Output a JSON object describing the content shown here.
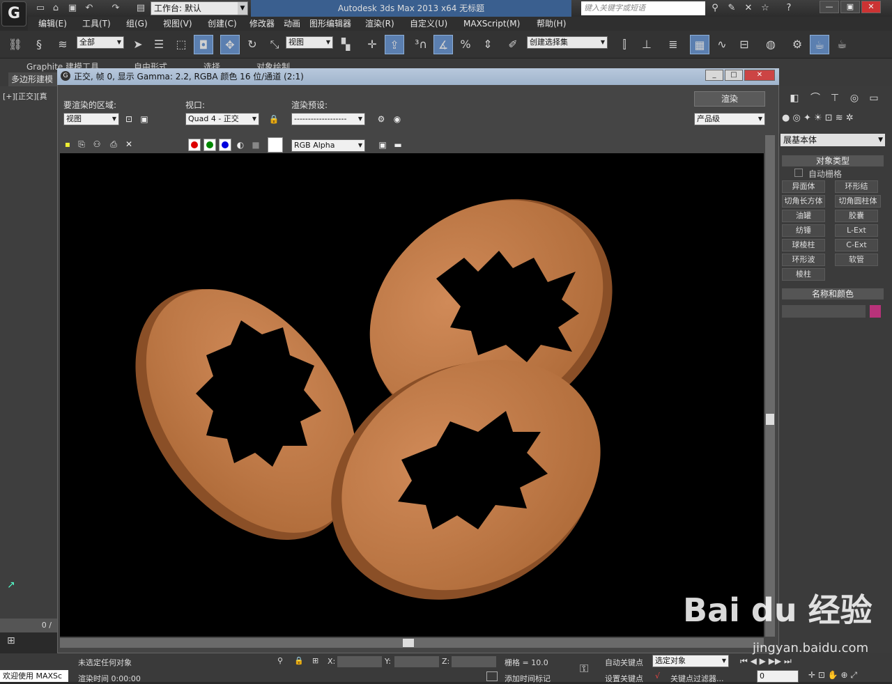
{
  "app": {
    "logo": "G",
    "title": "Autodesk 3ds Max  2013 x64      无标题",
    "workspace": "工作台: 默认",
    "search_placeholder": "键入关键字或短语"
  },
  "menu": [
    "编辑(E)",
    "工具(T)",
    "组(G)",
    "视图(V)",
    "创建(C)",
    "修改器",
    "动画",
    "图形编辑器",
    "渲染(R)",
    "自定义(U)",
    "MAXScript(M)",
    "帮助(H)"
  ],
  "toolbar": {
    "filter": "全部",
    "ref_coord": "视图",
    "selection_set": "创建选择集"
  },
  "ribbon": {
    "tabs": [
      "Graphite 建模工具",
      "自由形式",
      "选择",
      "对象绘制"
    ],
    "sub": "多边形建模"
  },
  "left_viewport": {
    "label": "[+][正交][真",
    "frame": "0 /"
  },
  "render_window": {
    "title": "正交, 帧 0, 显示 Gamma: 2.2, RGBA 颜色 16 位/通道 (2:1)",
    "area_label": "要渲染的区域:",
    "area_value": "视图",
    "viewport_label": "视口:",
    "viewport_value": "Quad 4 - 正交",
    "preset_label": "渲染预设:",
    "preset_value": "-------------------",
    "render_button": "渲染",
    "quality": "产品级",
    "channel": "RGB Alpha"
  },
  "right_panel": {
    "dropdown": "展基本体",
    "object_type_header": "对象类型",
    "autogrid": "自动栅格",
    "buttons": [
      "异面体",
      "环形结",
      "切角长方体",
      "切角圆柱体",
      "油罐",
      "胶囊",
      "纺锤",
      "L-Ext",
      "球棱柱",
      "C-Ext",
      "环形波",
      "软管",
      "棱柱"
    ],
    "name_color_header": "名称和颜色",
    "object_color": "#b8327a"
  },
  "status": {
    "selection": "未选定任何对象",
    "render_time": "渲染时间  0:00:00",
    "welcome": "欢迎使用 MAXSc",
    "x_label": "X:",
    "y_label": "Y:",
    "z_label": "Z:",
    "grid": "栅格 = 10.0",
    "add_time_tag": "添加时间标记",
    "auto_key": "自动关键点",
    "set_key": "设置关键点",
    "selected_object": "选定对象",
    "key_filters": "关键点过滤器...",
    "frame_value": "0"
  },
  "watermark": {
    "logo": "Bai du 经验",
    "url": "jingyan.baidu.com"
  },
  "colors": {
    "accent": "#5b7fb0",
    "render_bg": "#000000",
    "object": "#c8804f"
  }
}
